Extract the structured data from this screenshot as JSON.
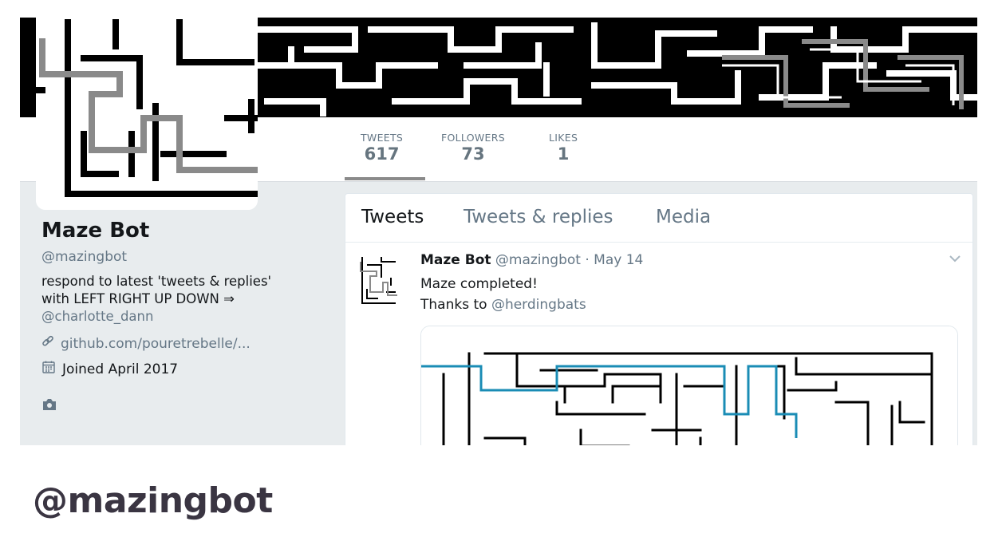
{
  "stats": [
    {
      "label": "TWEETS",
      "value": "617"
    },
    {
      "label": "FOLLOWERS",
      "value": "73"
    },
    {
      "label": "LIKES",
      "value": "1"
    }
  ],
  "profile": {
    "name": "Maze Bot",
    "handle": "@mazingbot",
    "bio_line1": "respond to latest 'tweets & replies'",
    "bio_line2": "with LEFT RIGHT UP DOWN ⇒",
    "bio_link": "@charlotte_dann",
    "website": "github.com/pouretrebelle/...",
    "joined": "Joined April 2017",
    "website_icon": "link-icon",
    "joined_icon": "calendar-icon",
    "photos_icon": "camera-icon"
  },
  "tabs": [
    {
      "label": "Tweets"
    },
    {
      "label": "Tweets & replies"
    },
    {
      "label": "Media"
    }
  ],
  "tweet": {
    "name": "Maze Bot",
    "meta": "@mazingbot · May 14",
    "line1": "Maze completed!",
    "line2_prefix": "Thanks to ",
    "line2_mention": "@herdingbats",
    "caret_icon": "chevron-down-icon"
  },
  "caption": "@mazingbot",
  "colors": {
    "maze_path": "#1a8cb5",
    "maze_gray": "#8a8a8a",
    "muted_text": "#657786"
  }
}
